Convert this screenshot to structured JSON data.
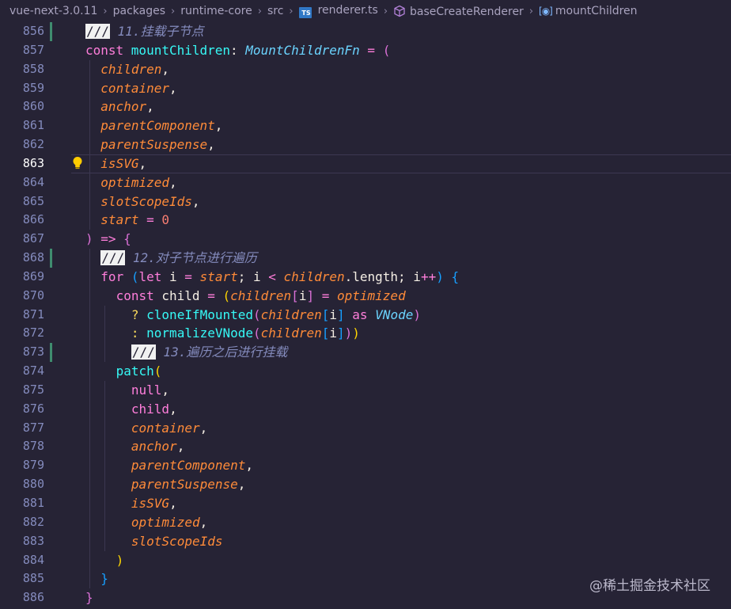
{
  "breadcrumb": {
    "items": [
      {
        "label": "vue-next-3.0.11",
        "icon": ""
      },
      {
        "label": "packages",
        "icon": ""
      },
      {
        "label": "runtime-core",
        "icon": ""
      },
      {
        "label": "src",
        "icon": ""
      },
      {
        "label": "renderer.ts",
        "icon": "typescript-file-icon",
        "icon_text": "TS"
      },
      {
        "label": "baseCreateRenderer",
        "icon": "method-cube-icon"
      },
      {
        "label": "mountChildren",
        "icon": "field-icon"
      }
    ]
  },
  "editor": {
    "active_line": 863,
    "modified_lines": [
      856,
      868,
      873
    ],
    "lightbulb_line": 863,
    "lines": [
      {
        "n": 856,
        "indent": 0,
        "tokens": [
          {
            "t": "///",
            "c": "t-slash"
          },
          {
            "t": " 11.挂载子节点",
            "c": "t-com"
          }
        ]
      },
      {
        "n": 857,
        "indent": 0,
        "tokens": [
          {
            "t": "const ",
            "c": "t-kw2"
          },
          {
            "t": "mountChildren",
            "c": "t-fn"
          },
          {
            "t": ": ",
            "c": "t-plain"
          },
          {
            "t": "MountChildrenFn",
            "c": "t-blue"
          },
          {
            "t": " = ",
            "c": "t-kw2"
          },
          {
            "t": "(",
            "c": "t-bracket2"
          }
        ]
      },
      {
        "n": 858,
        "indent": 1,
        "tokens": [
          {
            "t": "children",
            "c": "t-param"
          },
          {
            "t": ",",
            "c": "t-plain"
          }
        ]
      },
      {
        "n": 859,
        "indent": 1,
        "tokens": [
          {
            "t": "container",
            "c": "t-param"
          },
          {
            "t": ",",
            "c": "t-plain"
          }
        ]
      },
      {
        "n": 860,
        "indent": 1,
        "tokens": [
          {
            "t": "anchor",
            "c": "t-param"
          },
          {
            "t": ",",
            "c": "t-plain"
          }
        ]
      },
      {
        "n": 861,
        "indent": 1,
        "tokens": [
          {
            "t": "parentComponent",
            "c": "t-param"
          },
          {
            "t": ",",
            "c": "t-plain"
          }
        ]
      },
      {
        "n": 862,
        "indent": 1,
        "tokens": [
          {
            "t": "parentSuspense",
            "c": "t-param"
          },
          {
            "t": ",",
            "c": "t-plain"
          }
        ]
      },
      {
        "n": 863,
        "indent": 1,
        "tokens": [
          {
            "t": "isSVG",
            "c": "t-param"
          },
          {
            "t": ",",
            "c": "t-plain"
          }
        ]
      },
      {
        "n": 864,
        "indent": 1,
        "tokens": [
          {
            "t": "optimized",
            "c": "t-param"
          },
          {
            "t": ",",
            "c": "t-plain"
          }
        ]
      },
      {
        "n": 865,
        "indent": 1,
        "tokens": [
          {
            "t": "slotScopeIds",
            "c": "t-param"
          },
          {
            "t": ",",
            "c": "t-plain"
          }
        ]
      },
      {
        "n": 866,
        "indent": 1,
        "tokens": [
          {
            "t": "start",
            "c": "t-param"
          },
          {
            "t": " = ",
            "c": "t-kw2"
          },
          {
            "t": "0",
            "c": "t-num"
          }
        ]
      },
      {
        "n": 867,
        "indent": 0,
        "tokens": [
          {
            "t": ")",
            "c": "t-bracket2"
          },
          {
            "t": " => ",
            "c": "t-kw2"
          },
          {
            "t": "{",
            "c": "t-bracket2"
          }
        ]
      },
      {
        "n": 868,
        "indent": 1,
        "tokens": [
          {
            "t": "///",
            "c": "t-slash"
          },
          {
            "t": " 12.对子节点进行遍历",
            "c": "t-com"
          }
        ]
      },
      {
        "n": 869,
        "indent": 1,
        "tokens": [
          {
            "t": "for ",
            "c": "t-kw2"
          },
          {
            "t": "(",
            "c": "t-bracket3"
          },
          {
            "t": "let ",
            "c": "t-kw2"
          },
          {
            "t": "i",
            "c": "t-plain"
          },
          {
            "t": " = ",
            "c": "t-kw2"
          },
          {
            "t": "start",
            "c": "t-param"
          },
          {
            "t": "; ",
            "c": "t-plain"
          },
          {
            "t": "i",
            "c": "t-plain"
          },
          {
            "t": " < ",
            "c": "t-kw2"
          },
          {
            "t": "children",
            "c": "t-param"
          },
          {
            "t": ".length; ",
            "c": "t-plain"
          },
          {
            "t": "i",
            "c": "t-plain"
          },
          {
            "t": "++",
            "c": "t-kw2"
          },
          {
            "t": ")",
            "c": "t-bracket3"
          },
          {
            "t": " {",
            "c": "t-bracket3"
          }
        ]
      },
      {
        "n": 870,
        "indent": 2,
        "tokens": [
          {
            "t": "const ",
            "c": "t-kw2"
          },
          {
            "t": "child",
            "c": "t-plain"
          },
          {
            "t": " = ",
            "c": "t-kw2"
          },
          {
            "t": "(",
            "c": "t-bracket1"
          },
          {
            "t": "children",
            "c": "t-param"
          },
          {
            "t": "[",
            "c": "t-bracket2"
          },
          {
            "t": "i",
            "c": "t-plain"
          },
          {
            "t": "]",
            "c": "t-bracket2"
          },
          {
            "t": " = ",
            "c": "t-kw2"
          },
          {
            "t": "optimized",
            "c": "t-param"
          }
        ]
      },
      {
        "n": 871,
        "indent": 3,
        "tokens": [
          {
            "t": "? ",
            "c": "t-kw"
          },
          {
            "t": "cloneIfMounted",
            "c": "t-fn"
          },
          {
            "t": "(",
            "c": "t-bracket2"
          },
          {
            "t": "children",
            "c": "t-param"
          },
          {
            "t": "[",
            "c": "t-bracket3"
          },
          {
            "t": "i",
            "c": "t-plain"
          },
          {
            "t": "]",
            "c": "t-bracket3"
          },
          {
            "t": " as ",
            "c": "t-kw2"
          },
          {
            "t": "VNode",
            "c": "t-blue"
          },
          {
            "t": ")",
            "c": "t-bracket2"
          }
        ]
      },
      {
        "n": 872,
        "indent": 3,
        "tokens": [
          {
            "t": ": ",
            "c": "t-kw"
          },
          {
            "t": "normalizeVNode",
            "c": "t-fn"
          },
          {
            "t": "(",
            "c": "t-bracket2"
          },
          {
            "t": "children",
            "c": "t-param"
          },
          {
            "t": "[",
            "c": "t-bracket3"
          },
          {
            "t": "i",
            "c": "t-plain"
          },
          {
            "t": "]",
            "c": "t-bracket3"
          },
          {
            "t": ")",
            "c": "t-bracket2"
          },
          {
            "t": ")",
            "c": "t-bracket1"
          }
        ]
      },
      {
        "n": 873,
        "indent": 3,
        "tokens": [
          {
            "t": "///",
            "c": "t-slash"
          },
          {
            "t": " 13.遍历之后进行挂载",
            "c": "t-com"
          }
        ]
      },
      {
        "n": 874,
        "indent": 2,
        "tokens": [
          {
            "t": "patch",
            "c": "t-fn"
          },
          {
            "t": "(",
            "c": "t-bracket1"
          }
        ]
      },
      {
        "n": 875,
        "indent": 3,
        "tokens": [
          {
            "t": "null",
            "c": "t-kw2"
          },
          {
            "t": ",",
            "c": "t-plain"
          }
        ]
      },
      {
        "n": 876,
        "indent": 3,
        "tokens": [
          {
            "t": "child",
            "c": "t-kw2"
          },
          {
            "t": ",",
            "c": "t-plain"
          }
        ]
      },
      {
        "n": 877,
        "indent": 3,
        "tokens": [
          {
            "t": "container",
            "c": "t-param"
          },
          {
            "t": ",",
            "c": "t-plain"
          }
        ]
      },
      {
        "n": 878,
        "indent": 3,
        "tokens": [
          {
            "t": "anchor",
            "c": "t-param"
          },
          {
            "t": ",",
            "c": "t-plain"
          }
        ]
      },
      {
        "n": 879,
        "indent": 3,
        "tokens": [
          {
            "t": "parentComponent",
            "c": "t-param"
          },
          {
            "t": ",",
            "c": "t-plain"
          }
        ]
      },
      {
        "n": 880,
        "indent": 3,
        "tokens": [
          {
            "t": "parentSuspense",
            "c": "t-param"
          },
          {
            "t": ",",
            "c": "t-plain"
          }
        ]
      },
      {
        "n": 881,
        "indent": 3,
        "tokens": [
          {
            "t": "isSVG",
            "c": "t-param"
          },
          {
            "t": ",",
            "c": "t-plain"
          }
        ]
      },
      {
        "n": 882,
        "indent": 3,
        "tokens": [
          {
            "t": "optimized",
            "c": "t-param"
          },
          {
            "t": ",",
            "c": "t-plain"
          }
        ]
      },
      {
        "n": 883,
        "indent": 3,
        "tokens": [
          {
            "t": "slotScopeIds",
            "c": "t-param"
          }
        ]
      },
      {
        "n": 884,
        "indent": 2,
        "tokens": [
          {
            "t": ")",
            "c": "t-bracket1"
          }
        ]
      },
      {
        "n": 885,
        "indent": 1,
        "tokens": [
          {
            "t": "}",
            "c": "t-bracket3"
          }
        ]
      },
      {
        "n": 886,
        "indent": 0,
        "tokens": [
          {
            "t": "}",
            "c": "t-bracket2"
          }
        ]
      }
    ]
  },
  "watermark": {
    "text": "@稀土掘金技术社区"
  },
  "colors": {
    "background": "#262335",
    "line_number": "#848bbd",
    "modified_marker": "#3f8c6f",
    "lightbulb": "#ffcc00"
  }
}
